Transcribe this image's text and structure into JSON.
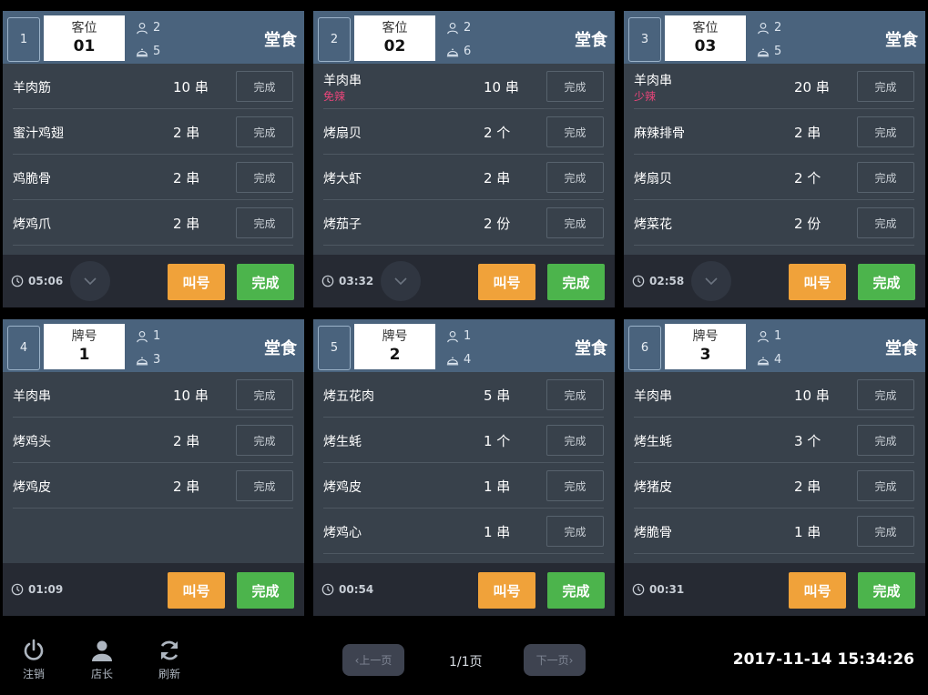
{
  "orders": [
    {
      "number": "1",
      "seat_label": "客位",
      "seat_value": "01",
      "people": "2",
      "dishes": "5",
      "service": "堂食",
      "items": [
        {
          "name": "羊肉筋",
          "note": "",
          "qty": "10 串",
          "button": "完成"
        },
        {
          "name": "蜜汁鸡翅",
          "note": "",
          "qty": "2 串",
          "button": "完成"
        },
        {
          "name": "鸡脆骨",
          "note": "",
          "qty": "2 串",
          "button": "完成"
        },
        {
          "name": "烤鸡爪",
          "note": "",
          "qty": "2 串",
          "button": "完成"
        }
      ],
      "timer": "05:06",
      "has_collapse": true,
      "call_label": "叫号",
      "done_label": "完成"
    },
    {
      "number": "2",
      "seat_label": "客位",
      "seat_value": "02",
      "people": "2",
      "dishes": "6",
      "service": "堂食",
      "items": [
        {
          "name": "羊肉串",
          "note": "免辣",
          "qty": "10 串",
          "button": "完成"
        },
        {
          "name": "烤扇贝",
          "note": "",
          "qty": "2 个",
          "button": "完成"
        },
        {
          "name": "烤大虾",
          "note": "",
          "qty": "2 串",
          "button": "完成"
        },
        {
          "name": "烤茄子",
          "note": "",
          "qty": "2 份",
          "button": "完成"
        }
      ],
      "timer": "03:32",
      "has_collapse": true,
      "call_label": "叫号",
      "done_label": "完成"
    },
    {
      "number": "3",
      "seat_label": "客位",
      "seat_value": "03",
      "people": "2",
      "dishes": "5",
      "service": "堂食",
      "items": [
        {
          "name": "羊肉串",
          "note": "少辣",
          "qty": "20 串",
          "button": "完成"
        },
        {
          "name": "麻辣排骨",
          "note": "",
          "qty": "2 串",
          "button": "完成"
        },
        {
          "name": "烤扇贝",
          "note": "",
          "qty": "2 个",
          "button": "完成"
        },
        {
          "name": "烤菜花",
          "note": "",
          "qty": "2 份",
          "button": "完成"
        }
      ],
      "timer": "02:58",
      "has_collapse": true,
      "call_label": "叫号",
      "done_label": "完成"
    },
    {
      "number": "4",
      "seat_label": "牌号",
      "seat_value": "1",
      "people": "1",
      "dishes": "3",
      "service": "堂食",
      "items": [
        {
          "name": "羊肉串",
          "note": "",
          "qty": "10 串",
          "button": "完成"
        },
        {
          "name": "烤鸡头",
          "note": "",
          "qty": "2 串",
          "button": "完成"
        },
        {
          "name": "烤鸡皮",
          "note": "",
          "qty": "2 串",
          "button": "完成"
        }
      ],
      "timer": "01:09",
      "has_collapse": false,
      "call_label": "叫号",
      "done_label": "完成"
    },
    {
      "number": "5",
      "seat_label": "牌号",
      "seat_value": "2",
      "people": "1",
      "dishes": "4",
      "service": "堂食",
      "items": [
        {
          "name": "烤五花肉",
          "note": "",
          "qty": "5 串",
          "button": "完成"
        },
        {
          "name": "烤生蚝",
          "note": "",
          "qty": "1 个",
          "button": "完成"
        },
        {
          "name": "烤鸡皮",
          "note": "",
          "qty": "1 串",
          "button": "完成"
        },
        {
          "name": "烤鸡心",
          "note": "",
          "qty": "1 串",
          "button": "完成"
        }
      ],
      "timer": "00:54",
      "has_collapse": false,
      "call_label": "叫号",
      "done_label": "完成"
    },
    {
      "number": "6",
      "seat_label": "牌号",
      "seat_value": "3",
      "people": "1",
      "dishes": "4",
      "service": "堂食",
      "items": [
        {
          "name": "羊肉串",
          "note": "",
          "qty": "10 串",
          "button": "完成"
        },
        {
          "name": "烤生蚝",
          "note": "",
          "qty": "3 个",
          "button": "完成"
        },
        {
          "name": "烤猪皮",
          "note": "",
          "qty": "2 串",
          "button": "完成"
        },
        {
          "name": "烤脆骨",
          "note": "",
          "qty": "1 串",
          "button": "完成"
        }
      ],
      "timer": "00:31",
      "has_collapse": false,
      "call_label": "叫号",
      "done_label": "完成"
    }
  ],
  "toolbar": {
    "logout_label": "注销",
    "manager_label": "店长",
    "refresh_label": "刷新"
  },
  "pager": {
    "prev_label": "上一页",
    "next_label": "下一页",
    "page_info": "1/1页"
  },
  "datetime": "2017-11-14 15:34:26",
  "icons": {
    "people": "person-icon",
    "dishes": "dish-cover-icon",
    "timer": "clock-icon",
    "collapse": "chevron-down-icon",
    "logout": "power-icon",
    "manager": "user-icon",
    "refresh": "refresh-icon"
  },
  "colors": {
    "header": "#4a637d",
    "card": "#38414b",
    "footer": "#262a33",
    "call": "#f0a23a",
    "done": "#4cb44c",
    "note": "#e8457a"
  }
}
